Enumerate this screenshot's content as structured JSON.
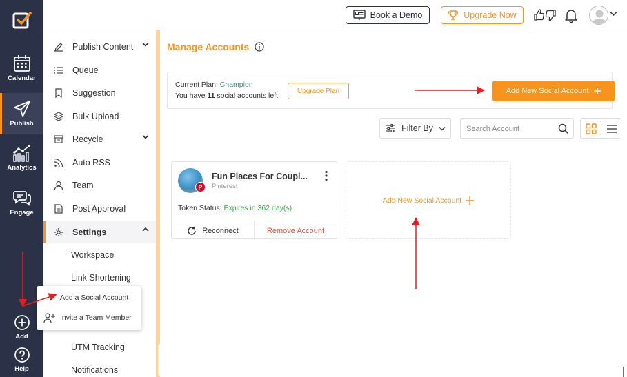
{
  "colors": {
    "rail_bg": "#2b3147",
    "accent": "#f7941d",
    "arrow": "#e02020",
    "ok": "#3aa34a",
    "remove": "#e0533d"
  },
  "rail": {
    "logo_icon": "checkbox-logo-icon",
    "items": [
      {
        "label": "Calendar",
        "icon": "calendar-icon"
      },
      {
        "label": "Publish",
        "icon": "paper-plane-icon"
      },
      {
        "label": "Analytics",
        "icon": "bar-chart-icon"
      },
      {
        "label": "Engage",
        "icon": "chat-bubbles-icon"
      },
      {
        "label": "Add",
        "icon": "plus-circle-icon"
      },
      {
        "label": "Help",
        "icon": "question-circle-icon"
      }
    ]
  },
  "topbar": {
    "book_demo": "Book a Demo",
    "upgrade_now": "Upgrade Now"
  },
  "submenu": {
    "items": [
      {
        "label": "Publish Content",
        "icon": "pencil-icon"
      },
      {
        "label": "Queue",
        "icon": "list-icon"
      },
      {
        "label": "Suggestion",
        "icon": "bookmark-icon"
      },
      {
        "label": "Bulk Upload",
        "icon": "layers-icon"
      },
      {
        "label": "Recycle",
        "icon": "archive-icon"
      },
      {
        "label": "Auto RSS",
        "icon": "rss-icon"
      },
      {
        "label": "Team",
        "icon": "user-icon"
      },
      {
        "label": "Post Approval",
        "icon": "document-icon"
      },
      {
        "label": "Settings",
        "icon": "gear-icon"
      }
    ],
    "settings_sub": [
      "Workspace",
      "Link Shortening",
      "UTM Tracking",
      "Notifications"
    ]
  },
  "popup": {
    "add_social": "Add a Social Account",
    "invite_team": "Invite a Team Member"
  },
  "main": {
    "title": "Manage Accounts",
    "plan": {
      "current_plan_label": "Current Plan: ",
      "current_plan_value": "Champion",
      "accounts_left_prefix": "You have ",
      "accounts_left_count": "11",
      "accounts_left_suffix": " social accounts left",
      "upgrade_plan": "Upgrade Plan",
      "add_new": "Add New Social Account"
    },
    "filter_by": "Filter By",
    "search_placeholder": "Search Account",
    "card": {
      "name": "Fun Places For Coupl...",
      "network": "Pinterest",
      "token_label": "Token Status: ",
      "token_value": "Expires in 362 day(s)",
      "reconnect": "Reconnect",
      "remove": "Remove Account"
    },
    "add_card_label": "Add New Social Account"
  }
}
